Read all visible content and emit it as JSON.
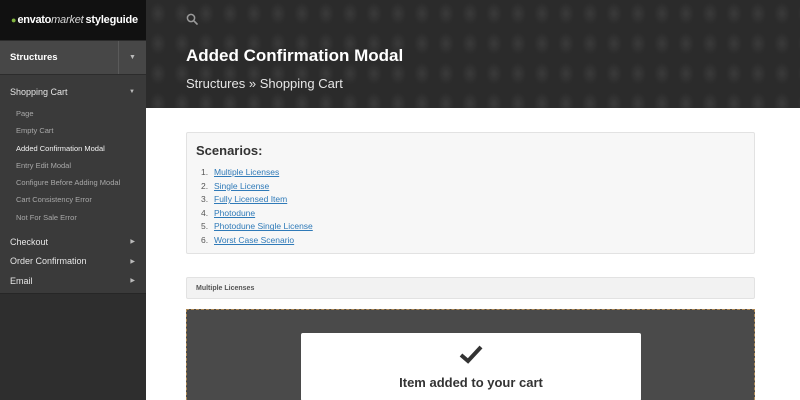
{
  "brand": {
    "envato": "envato",
    "market": "market",
    "styleguide": "styleguide"
  },
  "sidebar": {
    "section": "Structures",
    "groups": [
      {
        "label": "Shopping Cart",
        "items": [
          {
            "label": "Page"
          },
          {
            "label": "Empty Cart"
          },
          {
            "label": "Added Confirmation Modal"
          },
          {
            "label": "Entry Edit Modal"
          },
          {
            "label": "Configure Before Adding Modal"
          },
          {
            "label": "Cart Consistency Error"
          },
          {
            "label": "Not For Sale Error"
          }
        ]
      },
      {
        "label": "Checkout"
      },
      {
        "label": "Order Confirmation"
      },
      {
        "label": "Email"
      }
    ]
  },
  "header": {
    "title": "Added Confirmation Modal",
    "breadcrumb": "Structures » Shopping Cart"
  },
  "scenarios": {
    "title": "Scenarios:",
    "items": [
      {
        "num": "1.",
        "label": "Multiple Licenses"
      },
      {
        "num": "2.",
        "label": "Single License"
      },
      {
        "num": "3.",
        "label": "Fully Licensed Item"
      },
      {
        "num": "4.",
        "label": "Photodune"
      },
      {
        "num": "5.",
        "label": "Photodune Single License"
      },
      {
        "num": "6.",
        "label": "Worst Case Scenario"
      }
    ]
  },
  "section_bar": {
    "label": "Multiple Licenses"
  },
  "modal": {
    "title": "Item added to your cart",
    "icon": "check-icon"
  },
  "colors": {
    "accent_link": "#2f7ab8",
    "brand_green": "#82b440",
    "sidebar_bg": "#3a3a3a"
  }
}
